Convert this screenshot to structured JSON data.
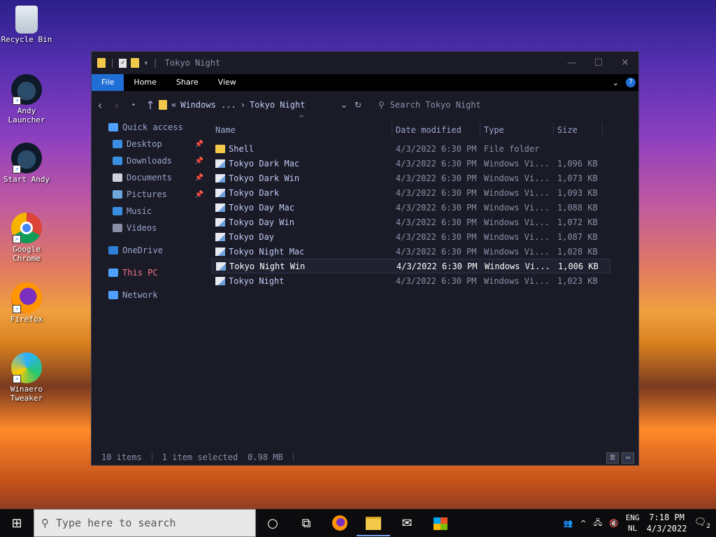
{
  "desktop_icons": [
    {
      "label": "Recycle Bin",
      "icon": "recycle-bin-icon"
    },
    {
      "label": "Andy Launcher",
      "icon": "andy-launcher-icon"
    },
    {
      "label": "Start Andy",
      "icon": "start-andy-icon"
    },
    {
      "label": "Google Chrome",
      "icon": "chrome-icon"
    },
    {
      "label": "Firefox",
      "icon": "firefox-icon"
    },
    {
      "label": "Winaero Tweaker",
      "icon": "winaero-icon"
    }
  ],
  "window": {
    "title": "Tokyo Night",
    "ribbon_tabs": [
      "File",
      "Home",
      "Share",
      "View"
    ],
    "help": "?",
    "address": {
      "prefix": "«",
      "parent": "Windows ...",
      "separator": "›",
      "current": "Tokyo Night"
    },
    "search_placeholder": "Search Tokyo Night",
    "nav": [
      {
        "label": "Quick access",
        "icon": "star-icon",
        "color": "#4ea1ff"
      },
      {
        "label": "Desktop",
        "icon": "desktop-icon",
        "pinned": true,
        "color": "#3a8fe0"
      },
      {
        "label": "Downloads",
        "icon": "download-icon",
        "pinned": true,
        "color": "#3a8fe0"
      },
      {
        "label": "Documents",
        "icon": "documents-icon",
        "pinned": true,
        "color": "#cfd3e0"
      },
      {
        "label": "Pictures",
        "icon": "pictures-icon",
        "pinned": true,
        "color": "#6fa8dc"
      },
      {
        "label": "Music",
        "icon": "music-icon",
        "color": "#3a8fe0"
      },
      {
        "label": "Videos",
        "icon": "videos-icon",
        "color": "#8a8fa8"
      },
      {
        "label": "OneDrive",
        "icon": "onedrive-icon",
        "color": "#2f80d8"
      },
      {
        "label": "This PC",
        "icon": "this-pc-icon",
        "color": "#4ea1ff",
        "highlight": "#f7768e"
      },
      {
        "label": "Network",
        "icon": "network-icon",
        "color": "#4ea1ff"
      }
    ],
    "columns": {
      "name": "Name",
      "date": "Date modified",
      "type": "Type",
      "size": "Size"
    },
    "files": [
      {
        "name": "Shell",
        "date": "4/3/2022 6:30 PM",
        "type": "File folder",
        "size": "",
        "kind": "folder"
      },
      {
        "name": "Tokyo Dark Mac",
        "date": "4/3/2022 6:30 PM",
        "type": "Windows Vi...",
        "size": "1,096 KB",
        "kind": "file"
      },
      {
        "name": "Tokyo Dark Win",
        "date": "4/3/2022 6:30 PM",
        "type": "Windows Vi...",
        "size": "1,073 KB",
        "kind": "file"
      },
      {
        "name": "Tokyo Dark",
        "date": "4/3/2022 6:30 PM",
        "type": "Windows Vi...",
        "size": "1,093 KB",
        "kind": "file"
      },
      {
        "name": "Tokyo Day Mac",
        "date": "4/3/2022 6:30 PM",
        "type": "Windows Vi...",
        "size": "1,088 KB",
        "kind": "file"
      },
      {
        "name": "Tokyo Day Win",
        "date": "4/3/2022 6:30 PM",
        "type": "Windows Vi...",
        "size": "1,072 KB",
        "kind": "file"
      },
      {
        "name": "Tokyo Day",
        "date": "4/3/2022 6:30 PM",
        "type": "Windows Vi...",
        "size": "1,087 KB",
        "kind": "file"
      },
      {
        "name": "Tokyo Night Mac",
        "date": "4/3/2022 6:30 PM",
        "type": "Windows Vi...",
        "size": "1,028 KB",
        "kind": "file"
      },
      {
        "name": "Tokyo Night Win",
        "date": "4/3/2022 6:30 PM",
        "type": "Windows Vi...",
        "size": "1,006 KB",
        "kind": "file",
        "selected": true
      },
      {
        "name": "Tokyo Night",
        "date": "4/3/2022 6:30 PM",
        "type": "Windows Vi...",
        "size": "1,023 KB",
        "kind": "file"
      }
    ],
    "status": {
      "count": "10 items",
      "selection": "1 item selected",
      "size": "0.98 MB"
    }
  },
  "taskbar": {
    "search_placeholder": "Type here to search",
    "apps": [
      "cortana-icon",
      "task-view-icon",
      "firefox-icon",
      "file-explorer-icon",
      "mail-icon",
      "store-icon"
    ],
    "lang_top": "ENG",
    "lang_bottom": "NL",
    "time": "7:18 PM",
    "date": "4/3/2022",
    "notifications": "2"
  }
}
